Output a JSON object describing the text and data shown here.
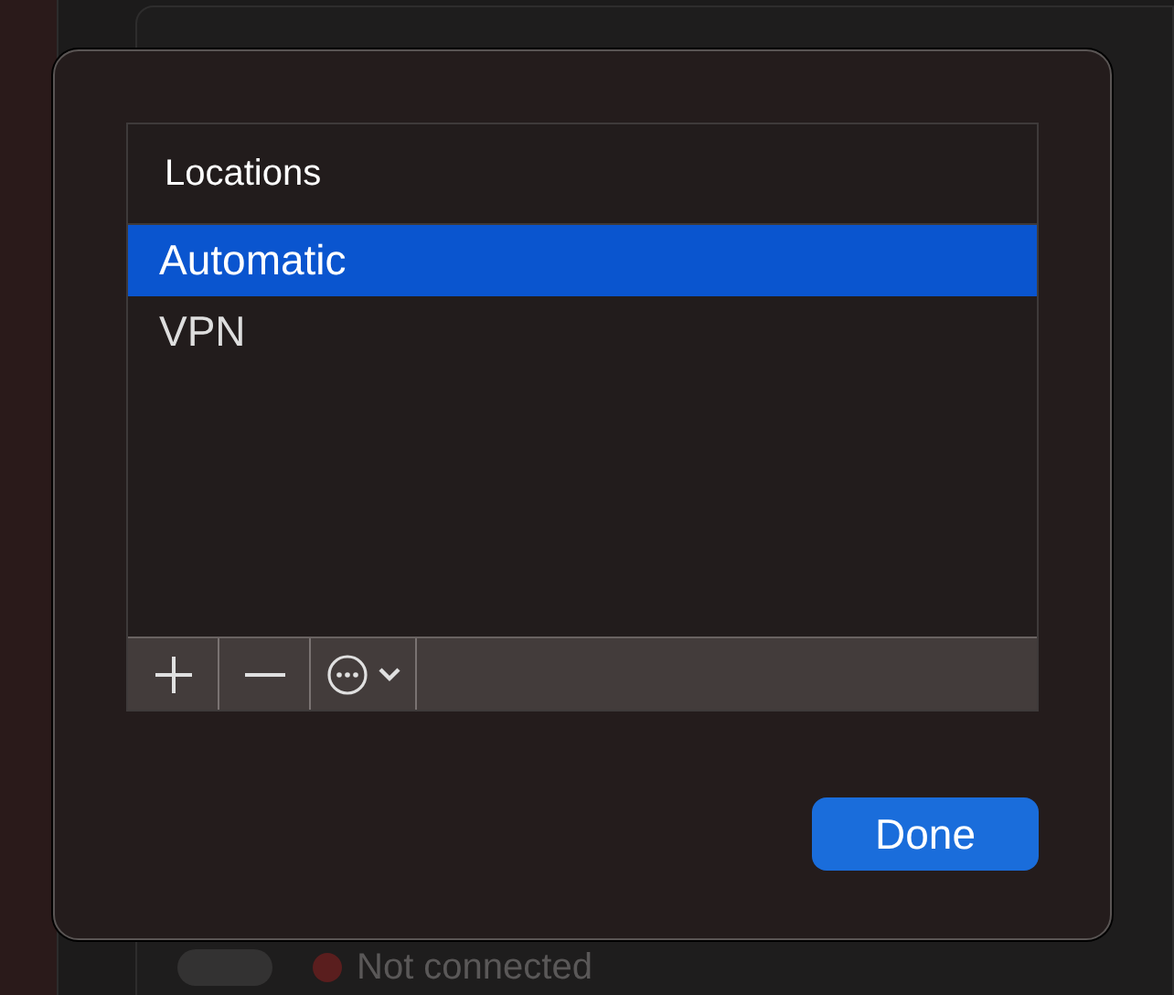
{
  "background": {
    "switch_on": false,
    "status": "Not connected"
  },
  "sheet": {
    "table": {
      "header": "Locations",
      "rows": [
        {
          "label": "Automatic",
          "selected": true
        },
        {
          "label": "VPN",
          "selected": false
        }
      ]
    },
    "done_button": "Done"
  }
}
